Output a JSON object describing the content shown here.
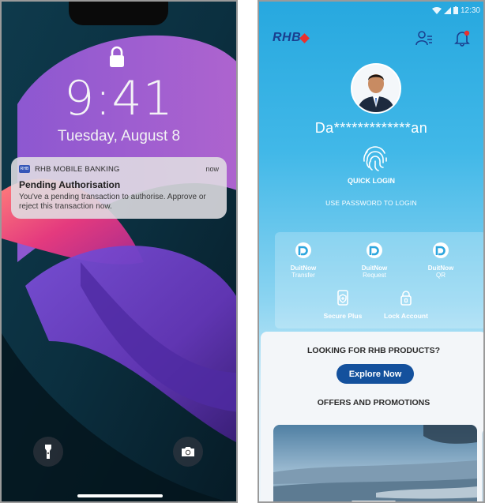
{
  "lock_screen": {
    "time": "9:41",
    "date": "Tuesday, August 8",
    "notification": {
      "app_icon_text": "RHB",
      "app_name": "RHB MOBILE BANKING",
      "time": "now",
      "title": "Pending Authorisation",
      "body": "You've a pending transaction to authorise. Approve or reject this transaction now."
    },
    "icons": [
      "lock-icon",
      "flashlight-icon",
      "camera-icon"
    ]
  },
  "rhb_app": {
    "status_bar": {
      "time": "12:30"
    },
    "brand": "RHB",
    "username": "Da*************an",
    "quick_login": "QUICK LOGIN",
    "use_password": "USE PASSWORD TO LOGIN",
    "actions": [
      {
        "line1": "DuitNow",
        "line2": "Transfer"
      },
      {
        "line1": "DuitNow",
        "line2": "Request"
      },
      {
        "line1": "DuitNow",
        "line2": "QR"
      },
      {
        "line1": "Secure Plus"
      },
      {
        "line1": "Lock Account"
      }
    ],
    "products_title": "LOOKING FOR RHB PRODUCTS?",
    "explore_button": "Explore Now",
    "offers_title": "OFFERS AND PROMOTIONS",
    "colors": {
      "brand_blue": "#1a3f8f",
      "accent_red": "#e8312f",
      "button_blue": "#14519d",
      "sky_top": "#27a8df"
    }
  }
}
